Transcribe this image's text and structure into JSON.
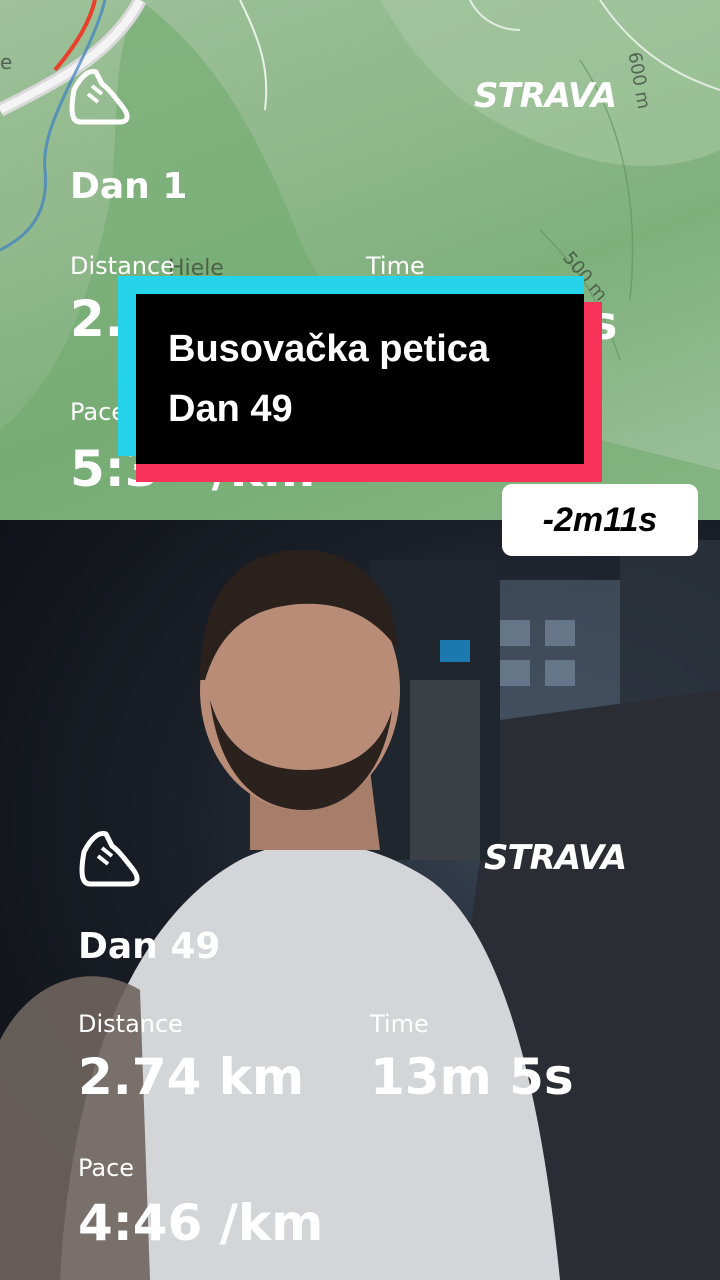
{
  "top_activity": {
    "brand": "STRAVA",
    "title": "Dan 1",
    "distance_label": "Distance",
    "distance_value": "2.",
    "time_label": "Time",
    "time_value": "s",
    "pace_label": "Pace",
    "pace_value": "5:3   /km",
    "map_labels": [
      "Hiele",
      "600 m",
      "500 m",
      "e"
    ]
  },
  "overlay": {
    "title_line1": "Busovačka petica",
    "title_line2": "Dan 49",
    "delta": "-2m11s"
  },
  "bottom_activity": {
    "brand": "STRAVA",
    "title": "Dan 49",
    "distance_label": "Distance",
    "distance_value": "2.74 km",
    "time_label": "Time",
    "time_value": "13m 5s",
    "pace_label": "Pace",
    "pace_value": "4:46 /km"
  },
  "colors": {
    "cyan": "#25d3ea",
    "pink": "#f7335a",
    "route": "#e8402a"
  }
}
